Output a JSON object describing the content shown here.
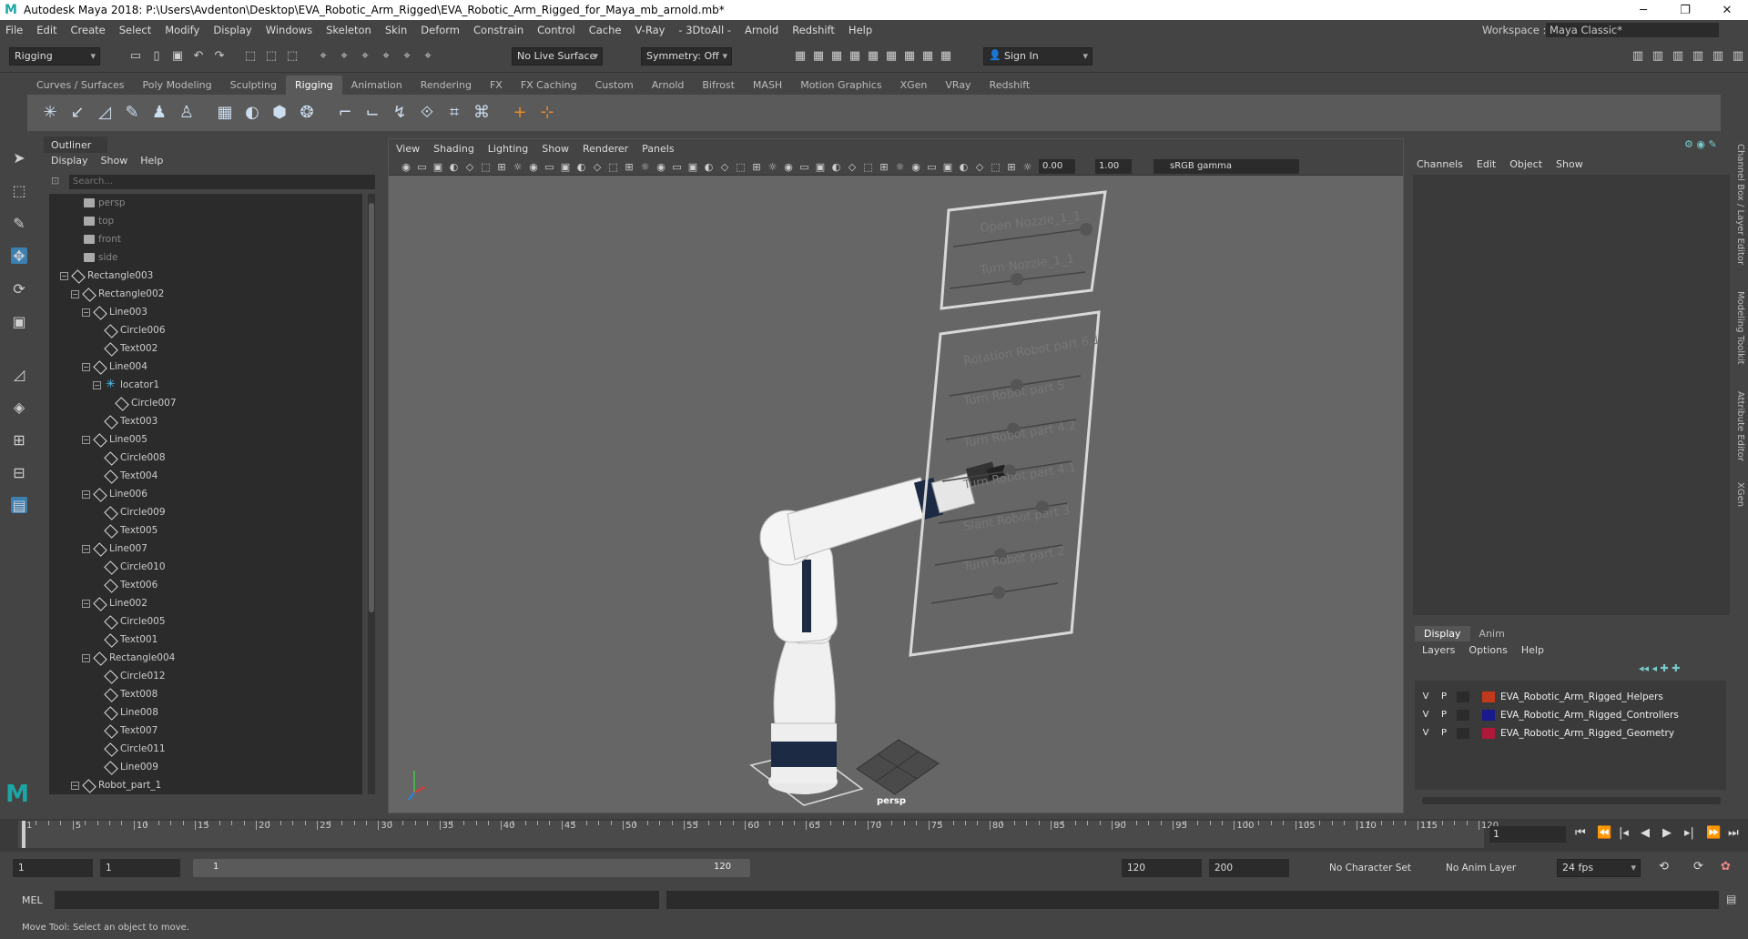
{
  "window": {
    "title": "Autodesk Maya 2018: P:\\Users\\Avdenton\\Desktop\\EVA_Robotic_Arm_Rigged\\EVA_Robotic_Arm_Rigged_for_Maya_mb_arnold.mb*"
  },
  "menu": [
    "File",
    "Edit",
    "Create",
    "Select",
    "Modify",
    "Display",
    "Windows",
    "Skeleton",
    "Skin",
    "Deform",
    "Constrain",
    "Control",
    "Cache",
    "V-Ray",
    "- 3DtoAll -",
    "Arnold",
    "Redshift",
    "Help"
  ],
  "workspace": {
    "label": "Workspace :",
    "value": "Maya Classic*"
  },
  "status": {
    "menuset": "Rigging",
    "live_surface": "No Live Surface",
    "symmetry": "Symmetry: Off",
    "sign_in": "Sign In"
  },
  "shelf_tabs": [
    "Curves / Surfaces",
    "Poly Modeling",
    "Sculpting",
    "Rigging",
    "Animation",
    "Rendering",
    "FX",
    "FX Caching",
    "Custom",
    "Arnold",
    "Bifrost",
    "MASH",
    "Motion Graphics",
    "XGen",
    "VRay",
    "Redshift"
  ],
  "outliner": {
    "title": "Outliner",
    "menu": [
      "Display",
      "Show",
      "Help"
    ],
    "search_placeholder": "Search...",
    "items": [
      {
        "label": "persp",
        "type": "cam",
        "depth": 0,
        "dim": true
      },
      {
        "label": "top",
        "type": "cam",
        "depth": 0,
        "dim": true
      },
      {
        "label": "front",
        "type": "cam",
        "depth": 0,
        "dim": true
      },
      {
        "label": "side",
        "type": "cam",
        "depth": 0,
        "dim": true
      },
      {
        "label": "Rectangle003",
        "type": "xf",
        "depth": 0,
        "exp": true
      },
      {
        "label": "Rectangle002",
        "type": "xf",
        "depth": 1,
        "exp": true
      },
      {
        "label": "Line003",
        "type": "xf",
        "depth": 2,
        "exp": true
      },
      {
        "label": "Circle006",
        "type": "xf",
        "depth": 3
      },
      {
        "label": "Text002",
        "type": "xf",
        "depth": 3
      },
      {
        "label": "Line004",
        "type": "xf",
        "depth": 2,
        "exp": true
      },
      {
        "label": "locator1",
        "type": "loc",
        "depth": 3,
        "exp": true
      },
      {
        "label": "Circle007",
        "type": "xf",
        "depth": 4
      },
      {
        "label": "Text003",
        "type": "xf",
        "depth": 3
      },
      {
        "label": "Line005",
        "type": "xf",
        "depth": 2,
        "exp": true
      },
      {
        "label": "Circle008",
        "type": "xf",
        "depth": 3
      },
      {
        "label": "Text004",
        "type": "xf",
        "depth": 3
      },
      {
        "label": "Line006",
        "type": "xf",
        "depth": 2,
        "exp": true
      },
      {
        "label": "Circle009",
        "type": "xf",
        "depth": 3
      },
      {
        "label": "Text005",
        "type": "xf",
        "depth": 3
      },
      {
        "label": "Line007",
        "type": "xf",
        "depth": 2,
        "exp": true
      },
      {
        "label": "Circle010",
        "type": "xf",
        "depth": 3
      },
      {
        "label": "Text006",
        "type": "xf",
        "depth": 3
      },
      {
        "label": "Line002",
        "type": "xf",
        "depth": 2,
        "exp": true
      },
      {
        "label": "Circle005",
        "type": "xf",
        "depth": 3
      },
      {
        "label": "Text001",
        "type": "xf",
        "depth": 3
      },
      {
        "label": "Rectangle004",
        "type": "xf",
        "depth": 2,
        "exp": true
      },
      {
        "label": "Circle012",
        "type": "xf",
        "depth": 3
      },
      {
        "label": "Text008",
        "type": "xf",
        "depth": 3
      },
      {
        "label": "Line008",
        "type": "xf",
        "depth": 3
      },
      {
        "label": "Text007",
        "type": "xf",
        "depth": 3
      },
      {
        "label": "Circle011",
        "type": "xf",
        "depth": 3
      },
      {
        "label": "Line009",
        "type": "xf",
        "depth": 3
      },
      {
        "label": "Robot_part_1",
        "type": "xf",
        "depth": 1,
        "exp": true
      }
    ]
  },
  "viewport": {
    "menu": [
      "View",
      "Shading",
      "Lighting",
      "Show",
      "Renderer",
      "Panels"
    ],
    "exposure": "0.00",
    "gamma": "1.00",
    "color_space": "sRGB gamma",
    "camera_label": "persp",
    "panel_top": [
      "Open Nozzle_1_1",
      "Turn Nozzle_1_1"
    ],
    "panel_bottom": [
      "Rotation Robot part 6.1",
      "Turn Robot part 5",
      "Turn Robot part 4.2",
      "Turn Robot part 4.1",
      "Slant Robot part 3",
      "Turn Robot part 2"
    ]
  },
  "channels": {
    "menu": [
      "Channels",
      "Edit",
      "Object",
      "Show"
    ]
  },
  "side_tabs": [
    "Channel Box / Layer Editor",
    "Modeling Toolkit",
    "Attribute Editor",
    "XGen"
  ],
  "layers": {
    "tabs": [
      "Display",
      "Anim"
    ],
    "menu": [
      "Layers",
      "Options",
      "Help"
    ],
    "rows": [
      {
        "v": "V",
        "p": "P",
        "color": "#c0391b",
        "name": "EVA_Robotic_Arm_Rigged_Helpers"
      },
      {
        "v": "V",
        "p": "P",
        "color": "#1a1a8c",
        "name": "EVA_Robotic_Arm_Rigged_Controllers"
      },
      {
        "v": "V",
        "p": "P",
        "color": "#b0183a",
        "name": "EVA_Robotic_Arm_Rigged_Geometry"
      }
    ]
  },
  "timeline": {
    "ticks": [
      1,
      5,
      10,
      15,
      20,
      25,
      30,
      35,
      40,
      45,
      50,
      55,
      60,
      65,
      70,
      75,
      80,
      85,
      90,
      95,
      100,
      105,
      110,
      115,
      120
    ],
    "current": "1"
  },
  "range": {
    "start": "1",
    "start2": "1",
    "bar_start": "1",
    "bar_end": "120",
    "end": "120",
    "end2": "200",
    "character": "No Character Set",
    "anim_layer": "No Anim Layer",
    "fps": "24 fps"
  },
  "cmd": {
    "label": "MEL"
  },
  "help": "Move Tool: Select an object to move."
}
